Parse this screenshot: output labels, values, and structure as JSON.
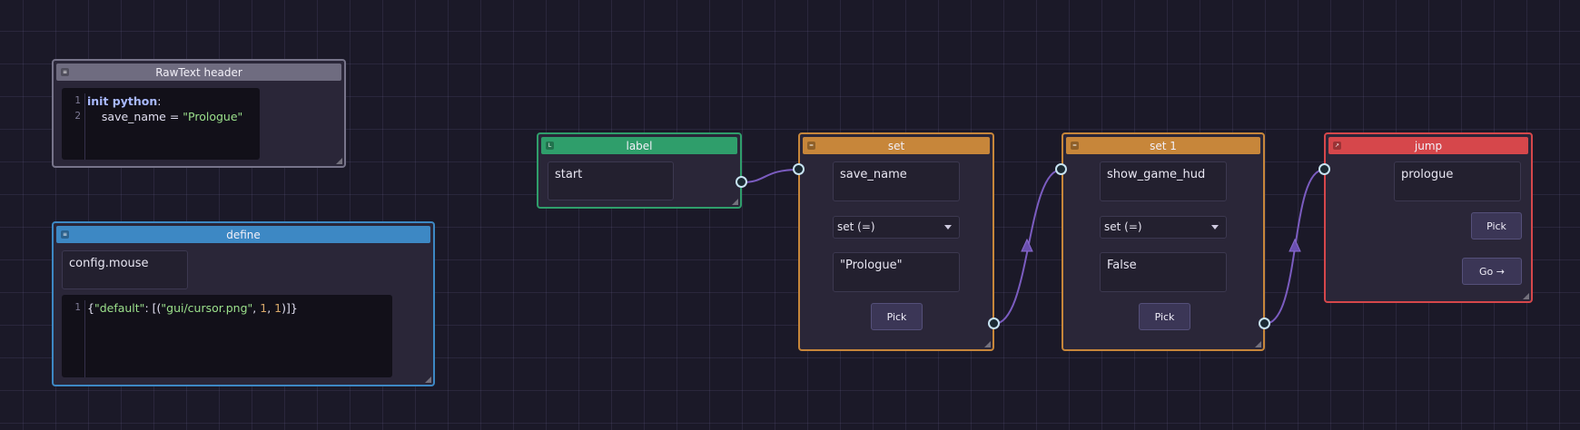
{
  "nodes": {
    "rawtext": {
      "title": "RawText header",
      "icon": "code-icon",
      "code_lines": [
        {
          "num": "1",
          "parts": [
            {
              "text": "init python",
              "style": "kw"
            },
            {
              "text": ":",
              "style": "plain"
            }
          ]
        },
        {
          "num": "2",
          "parts": [
            {
              "text": "    save_name = ",
              "style": "plain"
            },
            {
              "text": "\"Prologue\"",
              "style": "str"
            }
          ]
        }
      ]
    },
    "define": {
      "title": "define",
      "icon": "define-icon",
      "name_value": "config.mouse",
      "code_lines": [
        {
          "num": "1",
          "parts": [
            {
              "text": "{",
              "style": "plain"
            },
            {
              "text": "\"default\"",
              "style": "str"
            },
            {
              "text": ": [(",
              "style": "plain"
            },
            {
              "text": "\"gui/cursor.png\"",
              "style": "str"
            },
            {
              "text": ", ",
              "style": "plain"
            },
            {
              "text": "1",
              "style": "num"
            },
            {
              "text": ", ",
              "style": "plain"
            },
            {
              "text": "1",
              "style": "num"
            },
            {
              "text": ")]}",
              "style": "plain"
            }
          ]
        }
      ]
    },
    "label": {
      "title": "label",
      "icon": "label-icon",
      "name_value": "start"
    },
    "set": {
      "title": "set",
      "icon": "set-icon",
      "variable": "save_name",
      "operator": "set (=)",
      "value": "\"Prologue\"",
      "pick_label": "Pick"
    },
    "set1": {
      "title": "set 1",
      "icon": "set-icon",
      "variable": "show_game_hud",
      "operator": "set (=)",
      "value": "False",
      "pick_label": "Pick"
    },
    "jump": {
      "title": "jump",
      "icon": "jump-icon",
      "target": "prologue",
      "pick_label": "Pick",
      "go_label": "Go →"
    }
  },
  "colors": {
    "canvas_bg": "#1b1928",
    "rawtext": "#6f6c80",
    "define": "#3d88c4",
    "label": "#2f9e6b",
    "set": "#c7863a",
    "jump": "#d6474b",
    "wire": "#7b5cc0"
  }
}
